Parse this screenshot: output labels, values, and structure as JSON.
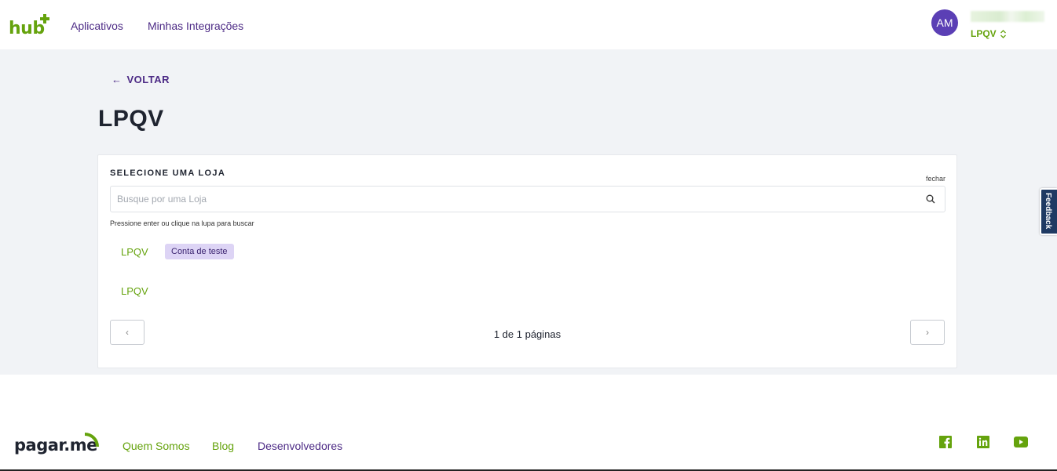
{
  "header": {
    "logo_text": "hub",
    "nav": [
      {
        "label": "Aplicativos"
      },
      {
        "label": "Minhas Integrações"
      }
    ],
    "user": {
      "initials": "AM",
      "store": "LPQV"
    }
  },
  "main": {
    "back_label": "VOLTAR",
    "title": "LPQV",
    "card": {
      "label": "SELECIONE UMA LOJA",
      "close_label": "fechar",
      "search_placeholder": "Busque por uma Loja",
      "hint": "Pressione enter ou clique na lupa para buscar",
      "stores": [
        {
          "name": "LPQV",
          "badge": "Conta de teste"
        },
        {
          "name": "LPQV"
        }
      ],
      "pagination": {
        "text": "1 de 1 páginas",
        "prev": "‹",
        "next": "›"
      }
    }
  },
  "feedback_label": "Feedback",
  "footer": {
    "logo_text": "pagar.me",
    "links": [
      {
        "label": "Quem Somos"
      },
      {
        "label": "Blog"
      },
      {
        "label": "Desenvolvedores"
      }
    ],
    "social": [
      "facebook-icon",
      "linkedin-icon",
      "youtube-icon"
    ]
  },
  "colors": {
    "brand_green": "#65a30d",
    "brand_purple": "#4c2a85",
    "avatar_purple": "#5b3fb5",
    "badge_bg": "#ddd4f5",
    "page_bg": "#f1f3f6",
    "feedback_bg": "#1f3a63"
  }
}
